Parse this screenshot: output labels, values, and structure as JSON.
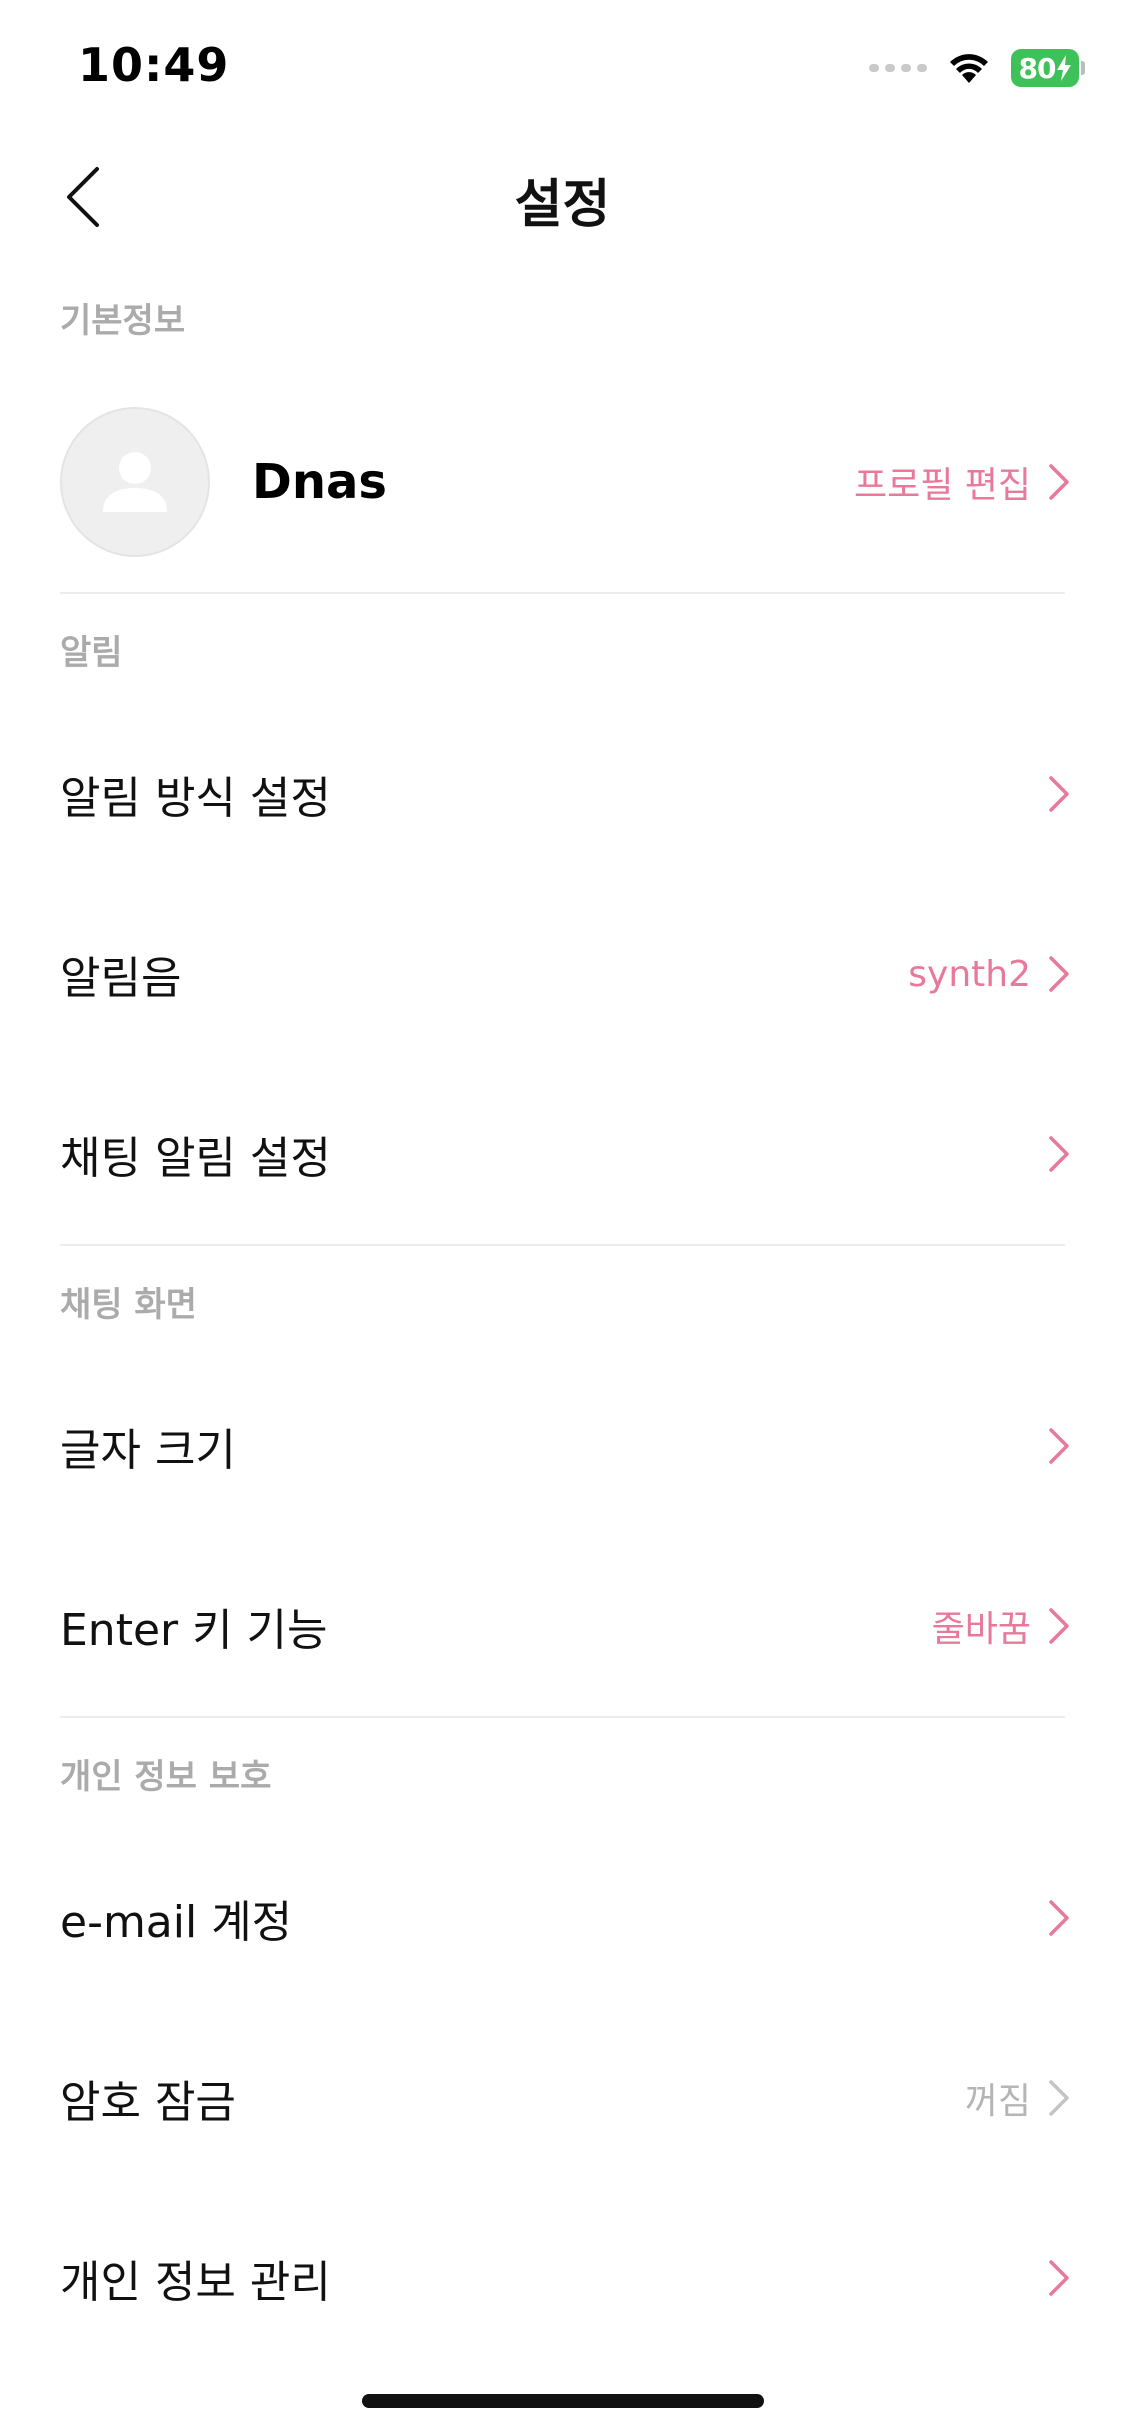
{
  "status_bar": {
    "time": "10:49",
    "battery_level": "80",
    "battery_color": "#3fc15a",
    "icons": [
      "signal-dots-icon",
      "wifi-icon",
      "battery-charging-icon"
    ]
  },
  "nav": {
    "title": "설정",
    "back_icon": "chevron-left-icon"
  },
  "colors": {
    "accent": "#e8799a",
    "section_header": "#ababab",
    "muted": "#b5b5b5",
    "divider": "#ededed"
  },
  "sections": {
    "basic": {
      "header": "기본정보",
      "profile": {
        "name": "Dnas",
        "action": "프로필 편집",
        "avatar_icon": "person-placeholder-icon"
      }
    },
    "notifications": {
      "header": "알림",
      "items": [
        {
          "label": "알림 방식 설정",
          "value": ""
        },
        {
          "label": "알림음",
          "value": "synth2"
        },
        {
          "label": "채팅 알림 설정",
          "value": ""
        }
      ]
    },
    "chat_screen": {
      "header": "채팅 화면",
      "items": [
        {
          "label": "글자 크기",
          "value": ""
        },
        {
          "label": "Enter 키 기능",
          "value": "줄바꿈"
        }
      ]
    },
    "privacy": {
      "header": "개인 정보 보호",
      "items": [
        {
          "label": "e-mail 계정",
          "value": ""
        },
        {
          "label": "암호 잠금",
          "value": "꺼짐"
        },
        {
          "label": "개인 정보 관리",
          "value": ""
        }
      ]
    }
  }
}
